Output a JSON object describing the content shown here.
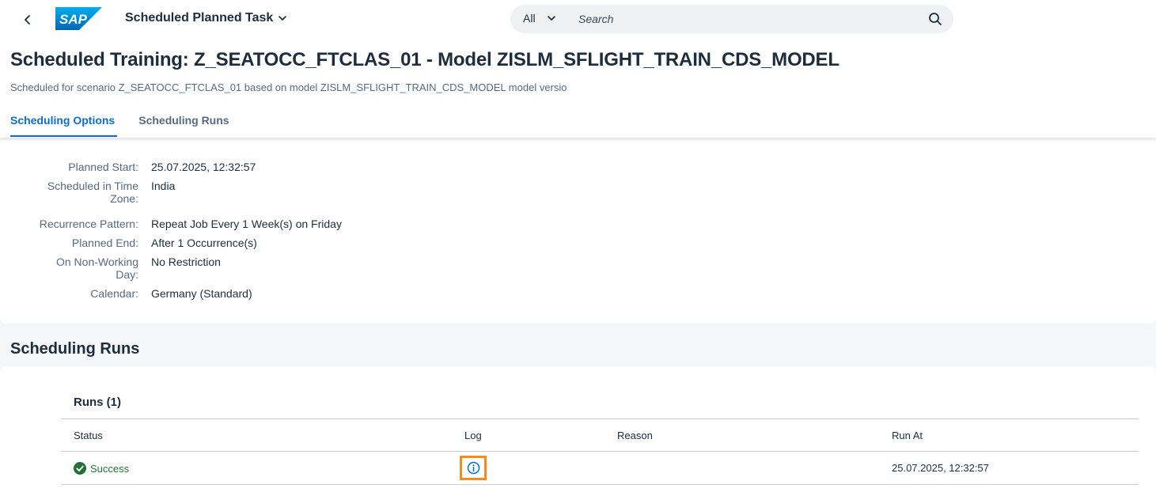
{
  "shellbar": {
    "app_title": "Scheduled Planned Task",
    "logo_text": "SAP",
    "search_scope": "All",
    "search_placeholder": "Search"
  },
  "header": {
    "title": "Scheduled Training: Z_SEATOCC_FTCLAS_01 - Model ZISLM_SFLIGHT_TRAIN_CDS_MODEL",
    "subtitle": "Scheduled for scenario Z_SEATOCC_FTCLAS_01 based on model ZISLM_SFLIGHT_TRAIN_CDS_MODEL model versio",
    "tabs": [
      {
        "label": "Scheduling Options"
      },
      {
        "label": "Scheduling Runs"
      }
    ]
  },
  "scheduling_options": {
    "planned_start_label": "Planned Start:",
    "planned_start_value": "25.07.2025, 12:32:57",
    "timezone_label_1": "Scheduled in Time",
    "timezone_label_2": "Zone:",
    "timezone_value": "India",
    "recurrence_label": "Recurrence Pattern:",
    "recurrence_value": "Repeat Job Every 1 Week(s) on Friday",
    "planned_end_label": "Planned End:",
    "planned_end_value": "After 1 Occurrence(s)",
    "nonworking_label_1": "On Non-Working",
    "nonworking_label_2": "Day:",
    "nonworking_value": "No Restriction",
    "calendar_label": "Calendar:",
    "calendar_value": "Germany (Standard)"
  },
  "runs": {
    "section_title": "Scheduling Runs",
    "table_title": "Runs (1)",
    "columns": {
      "status": "Status",
      "log": "Log",
      "reason": "Reason",
      "run_at": "Run At"
    },
    "rows": [
      {
        "status": "Success",
        "reason": "",
        "run_at": "25.07.2025, 12:32:57"
      }
    ]
  },
  "colors": {
    "brand_blue": "#0a6ed1",
    "success_green": "#256f3a",
    "highlight_orange": "#f58b1f"
  }
}
